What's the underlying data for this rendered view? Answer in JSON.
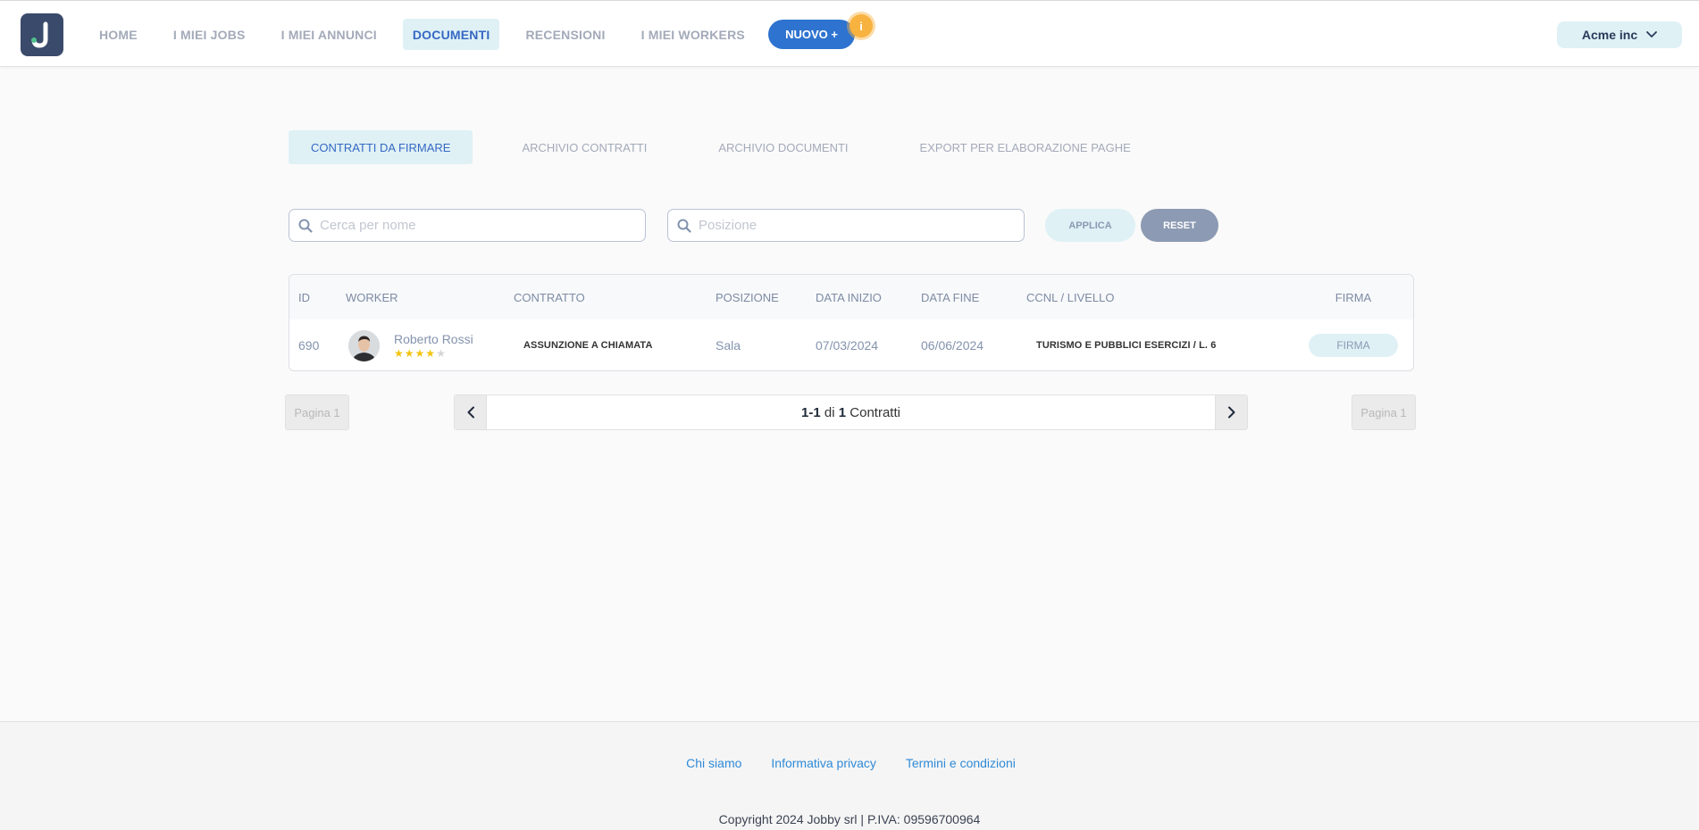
{
  "header": {
    "logo_letter": "J",
    "nav": [
      {
        "label": "HOME",
        "active": false
      },
      {
        "label": "I MIEI JOBS",
        "active": false
      },
      {
        "label": "I MIEI ANNUNCI",
        "active": false
      },
      {
        "label": "DOCUMENTI",
        "active": true
      },
      {
        "label": "RECENSIONI",
        "active": false
      },
      {
        "label": "I MIEI WORKERS",
        "active": false
      }
    ],
    "nuovo_label": "NUOVO +",
    "notification_badge": "i",
    "account_label": "Acme inc"
  },
  "tabs": [
    {
      "label": "CONTRATTI DA FIRMARE",
      "active": true
    },
    {
      "label": "ARCHIVIO CONTRATTI",
      "active": false
    },
    {
      "label": "ARCHIVIO DOCUMENTI",
      "active": false
    },
    {
      "label": "EXPORT PER ELABORAZIONE PAGHE",
      "active": false
    }
  ],
  "filters": {
    "name_placeholder": "Cerca per nome",
    "name_value": "",
    "position_placeholder": "Posizione",
    "position_value": "",
    "apply_label": "APPLICA",
    "reset_label": "RESET"
  },
  "table": {
    "columns": [
      "ID",
      "WORKER",
      "CONTRATTO",
      "POSIZIONE",
      "DATA INIZIO",
      "DATA FINE",
      "CCNL / LIVELLO",
      "FIRMA"
    ],
    "rows": [
      {
        "id": "690",
        "worker_name": "Roberto Rossi",
        "rating": 4,
        "rating_max": 5,
        "contratto": "ASSUNZIONE A CHIAMATA",
        "posizione": "Sala",
        "data_inizio": "07/03/2024",
        "data_fine": "06/06/2024",
        "ccnl": "TURISMO E PUBBLICI ESERCIZI / L. 6",
        "firma_label": "FIRMA"
      }
    ]
  },
  "pagination": {
    "page_label_left": "Pagina 1",
    "page_label_right": "Pagina 1",
    "range": "1-1",
    "of_word": "di",
    "total": "1",
    "unit": "Contratti"
  },
  "footer": {
    "links": [
      "Chi siamo",
      "Informativa privacy",
      "Termini e condizioni"
    ],
    "copyright": "Copyright 2024 Jobby srl | P.IVA: 09596700964"
  },
  "colors": {
    "brand_dark": "#3a4a6b",
    "primary_blue": "#2e73cf",
    "active_bg": "#dff1f5",
    "badge_orange": "#f8b23f",
    "star": "#f2c40f",
    "link": "#2f8ad8"
  }
}
